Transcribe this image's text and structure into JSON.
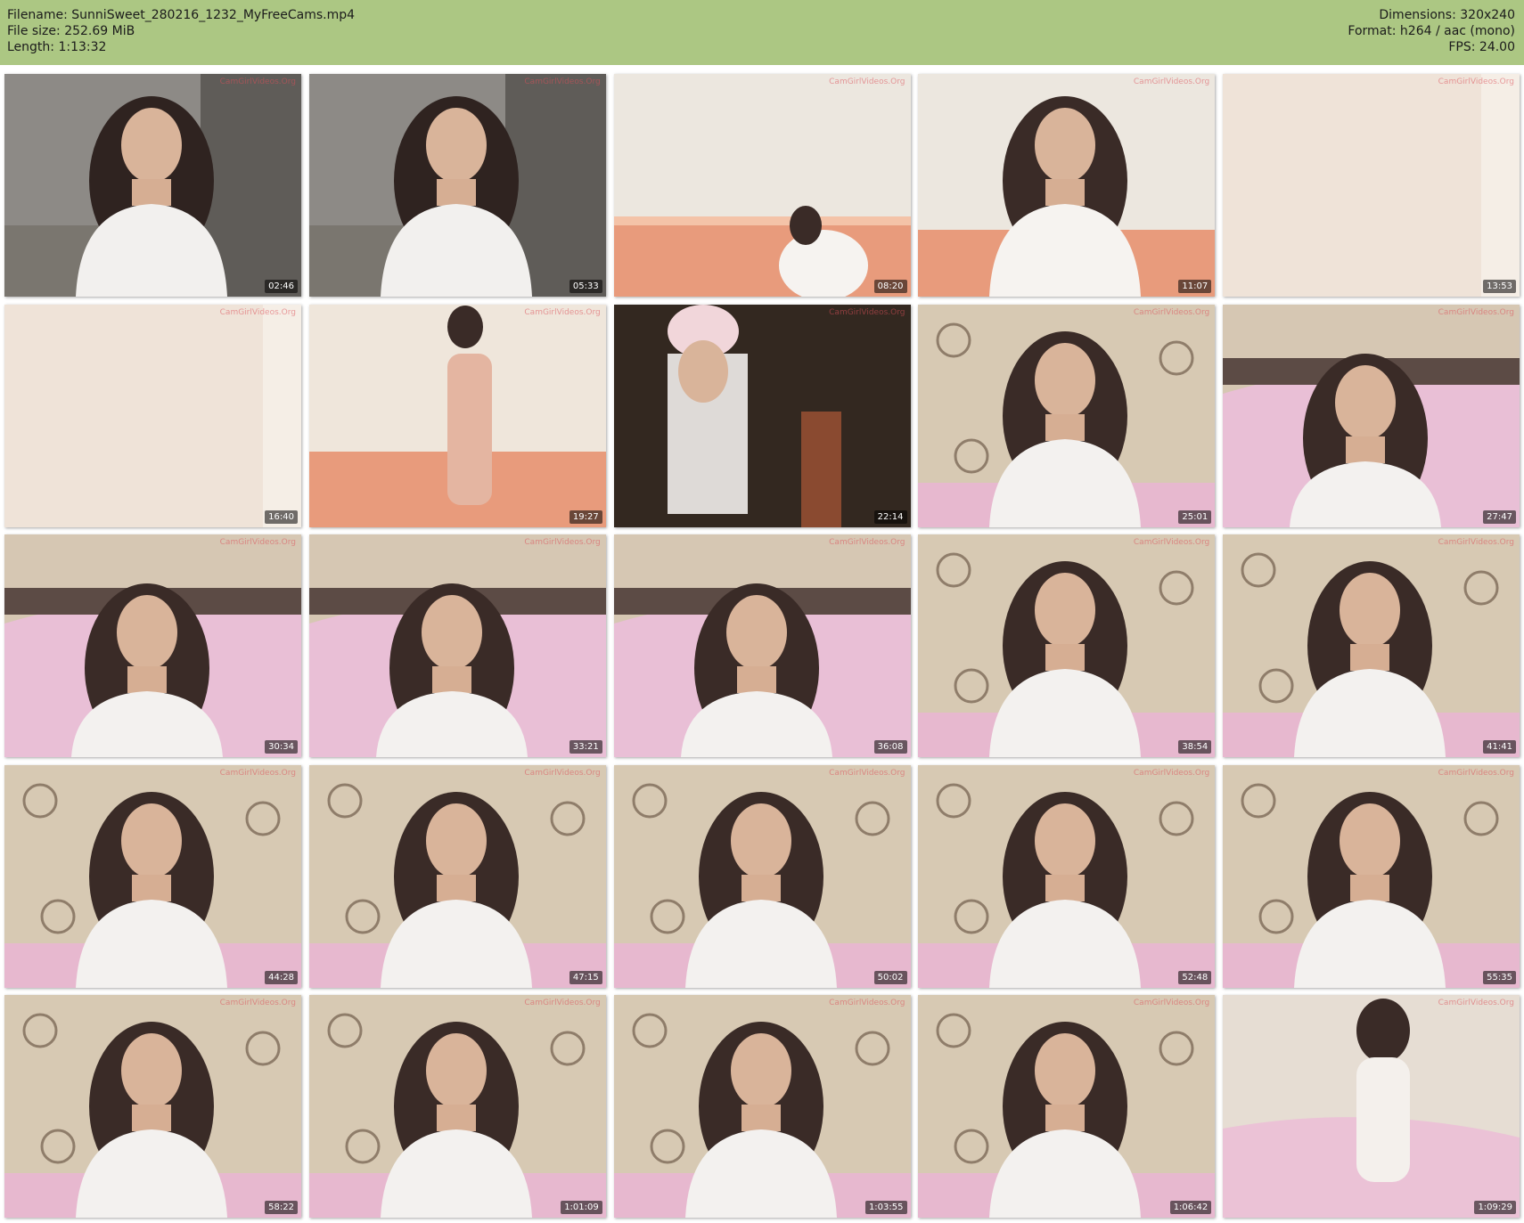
{
  "header": {
    "filename_line": "Filename: SunniSweet_280216_1232_MyFreeCams.mp4",
    "filesize_line": "File size: 252.69 MiB",
    "length_line": "Length: 1:13:32",
    "dimensions_line": "Dimensions: 320x240",
    "format_line": "Format: h264 / aac (mono)",
    "fps_line": "FPS: 24.00"
  },
  "colors": {
    "header_bg": "#acc783"
  },
  "thumbnails": [
    {
      "time": "02:46",
      "scene": "sofa",
      "watermark": "CamGirlVideos.Org"
    },
    {
      "time": "05:33",
      "scene": "sofa",
      "watermark": "CamGirlVideos.Org"
    },
    {
      "time": "08:20",
      "scene": "bathroom",
      "watermark": "CamGirlVideos.Org"
    },
    {
      "time": "11:07",
      "scene": "bathroom-person",
      "watermark": "CamGirlVideos.Org"
    },
    {
      "time": "13:53",
      "scene": "curtain",
      "watermark": "CamGirlVideos.Org"
    },
    {
      "time": "16:40",
      "scene": "curtain",
      "watermark": "CamGirlVideos.Org"
    },
    {
      "time": "19:27",
      "scene": "bathroom-towel",
      "watermark": "CamGirlVideos.Org"
    },
    {
      "time": "22:14",
      "scene": "hallway",
      "watermark": "CamGirlVideos.Org"
    },
    {
      "time": "25:01",
      "scene": "bedroom",
      "watermark": "CamGirlVideos.Org"
    },
    {
      "time": "27:47",
      "scene": "bedroom-pink",
      "watermark": "CamGirlVideos.Org"
    },
    {
      "time": "30:34",
      "scene": "bedroom-pink",
      "watermark": "CamGirlVideos.Org"
    },
    {
      "time": "33:21",
      "scene": "bedroom-pink",
      "watermark": "CamGirlVideos.Org"
    },
    {
      "time": "36:08",
      "scene": "bedroom-pink",
      "watermark": "CamGirlVideos.Org"
    },
    {
      "time": "38:54",
      "scene": "bedroom",
      "watermark": "CamGirlVideos.Org"
    },
    {
      "time": "41:41",
      "scene": "bedroom",
      "watermark": "CamGirlVideos.Org"
    },
    {
      "time": "44:28",
      "scene": "bedroom",
      "watermark": "CamGirlVideos.Org"
    },
    {
      "time": "47:15",
      "scene": "bedroom",
      "watermark": "CamGirlVideos.Org"
    },
    {
      "time": "50:02",
      "scene": "bedroom",
      "watermark": "CamGirlVideos.Org"
    },
    {
      "time": "52:48",
      "scene": "bedroom",
      "watermark": "CamGirlVideos.Org"
    },
    {
      "time": "55:35",
      "scene": "bedroom",
      "watermark": "CamGirlVideos.Org"
    },
    {
      "time": "58:22",
      "scene": "bedroom",
      "watermark": "CamGirlVideos.Org"
    },
    {
      "time": "1:01:09",
      "scene": "bedroom",
      "watermark": "CamGirlVideos.Org"
    },
    {
      "time": "1:03:55",
      "scene": "bedroom",
      "watermark": "CamGirlVideos.Org"
    },
    {
      "time": "1:06:42",
      "scene": "bedroom",
      "watermark": "CamGirlVideos.Org"
    },
    {
      "time": "1:09:29",
      "scene": "bedroom-light",
      "watermark": "CamGirlVideos.Org"
    }
  ]
}
